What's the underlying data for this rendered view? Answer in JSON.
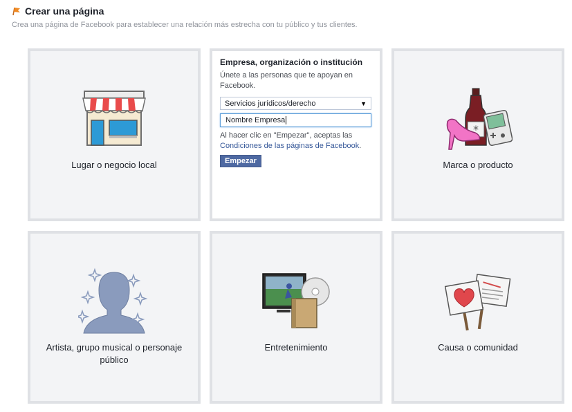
{
  "header": {
    "title": "Crear una página",
    "subtitle": "Crea una página de Facebook para establecer una relación más estrecha con tu público y tus clientes."
  },
  "categories": [
    {
      "label": "Lugar o negocio local",
      "icon": "storefront-icon"
    },
    {
      "label": "Empresa, organización o institución",
      "icon": ""
    },
    {
      "label": "Marca o producto",
      "icon": "brand-products-icon"
    },
    {
      "label": "Artista, grupo musical o personaje público",
      "icon": "artist-silhouette-icon"
    },
    {
      "label": "Entretenimiento",
      "icon": "entertainment-icon"
    },
    {
      "label": "Causa o comunidad",
      "icon": "cause-signs-icon"
    }
  ],
  "form": {
    "title": "Empresa, organización o institución",
    "description": "Únete a las personas que te apoyan en Facebook.",
    "select_value": "Servicios jurídicos/derecho",
    "input_value": "Nombre Empresa",
    "terms_prefix": "Al hacer clic en \"Empezar\", aceptas las",
    "terms_link": "Condiciones de las páginas de Facebook",
    "terms_suffix": ".",
    "button": "Empezar"
  },
  "colors": {
    "accent": "#4e69a2",
    "link": "#365899",
    "card_bg": "#f3f4f6",
    "card_border": "#dfe1e5"
  }
}
